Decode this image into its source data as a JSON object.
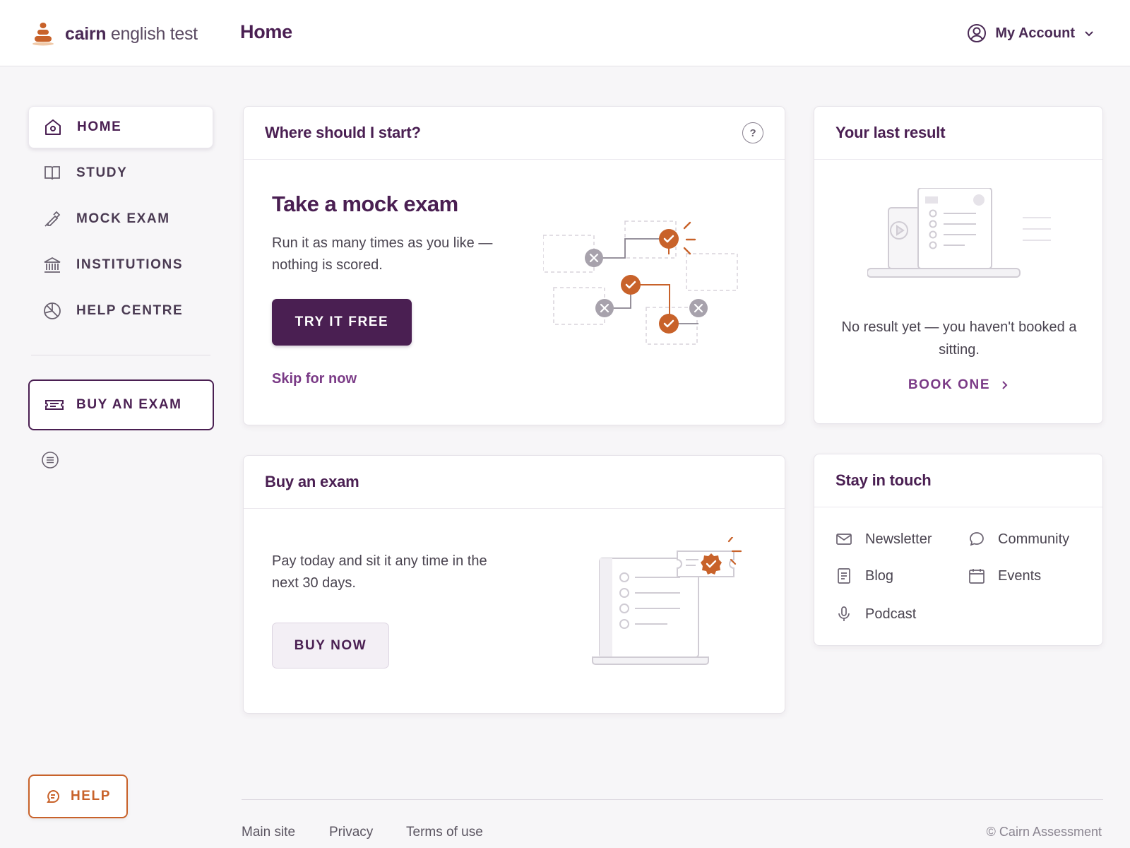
{
  "header": {
    "brand_bold": "cairn",
    "brand_rest": "english test",
    "page_title": "Home",
    "account_label": "My Account"
  },
  "sidebar": {
    "items": [
      {
        "label": "HOME",
        "icon": "home-icon",
        "active": true
      },
      {
        "label": "STUDY",
        "icon": "book-icon"
      },
      {
        "label": "MOCK EXAM",
        "icon": "pen-icon"
      },
      {
        "label": "INSTITUTIONS",
        "icon": "institution-icon"
      },
      {
        "label": "HELP CENTRE",
        "icon": "lifebuoy-icon"
      }
    ],
    "buy_label": "BUY AN EXAM",
    "help_label": "HELP"
  },
  "start_card": {
    "title": "Where should I start?",
    "help_glyph": "?",
    "heading": "Take a mock exam",
    "description": "Run it as many times as you like — nothing is scored.",
    "cta": "TRY IT FREE",
    "skip": "Skip for now"
  },
  "result_card": {
    "title": "Your last result",
    "note": "No result yet — you haven't booked a sitting.",
    "cta": "BOOK ONE"
  },
  "buy_card": {
    "title": "Buy an exam",
    "description": "Pay today and sit it any time in the next 30 days.",
    "cta": "BUY NOW"
  },
  "touch_card": {
    "title": "Stay in touch",
    "links": [
      {
        "label": "Newsletter",
        "icon": "mail-icon"
      },
      {
        "label": "Community",
        "icon": "chat-icon"
      },
      {
        "label": "Blog",
        "icon": "document-icon"
      },
      {
        "label": "Events",
        "icon": "calendar-icon"
      },
      {
        "label": "Podcast",
        "icon": "microphone-icon"
      }
    ]
  },
  "footer": {
    "links": [
      "Main site",
      "Privacy",
      "Terms of use"
    ],
    "copyright": "© Cairn Assessment"
  },
  "colors": {
    "brand_purple": "#4a1f52",
    "accent_purple": "#7a3a86",
    "accent_orange": "#c8622a"
  }
}
